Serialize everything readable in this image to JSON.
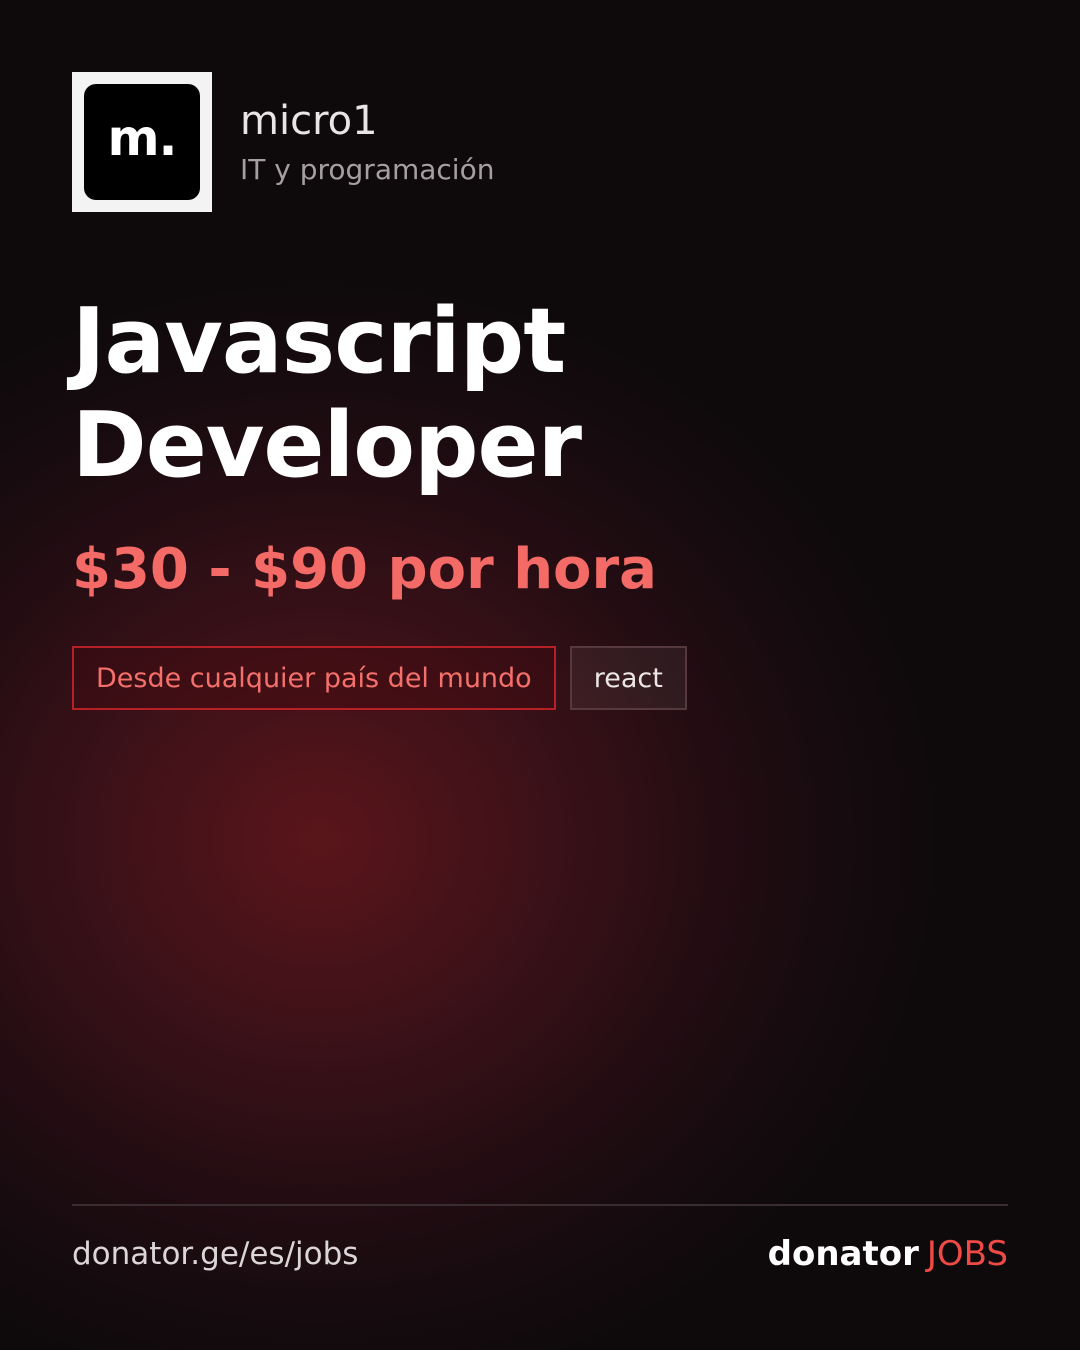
{
  "company": {
    "logo_text": "m.",
    "name": "micro1",
    "category": "IT y programación"
  },
  "job": {
    "title_line1": "Javascript",
    "title_line2": "Developer",
    "salary": "$30 - $90 por hora"
  },
  "tags": [
    {
      "label": "Desde cualquier país del mundo",
      "kind": "location"
    },
    {
      "label": "react",
      "kind": "skill"
    }
  ],
  "footer": {
    "url": "donator.ge/es/jobs",
    "brand_main": "donator",
    "brand_accent": "JOBS"
  },
  "colors": {
    "accent": "#f46a66",
    "brand_accent": "#ef4a45",
    "tag_border": "#b52126",
    "background": "#0e0a0c",
    "glow": "#5a151a"
  }
}
